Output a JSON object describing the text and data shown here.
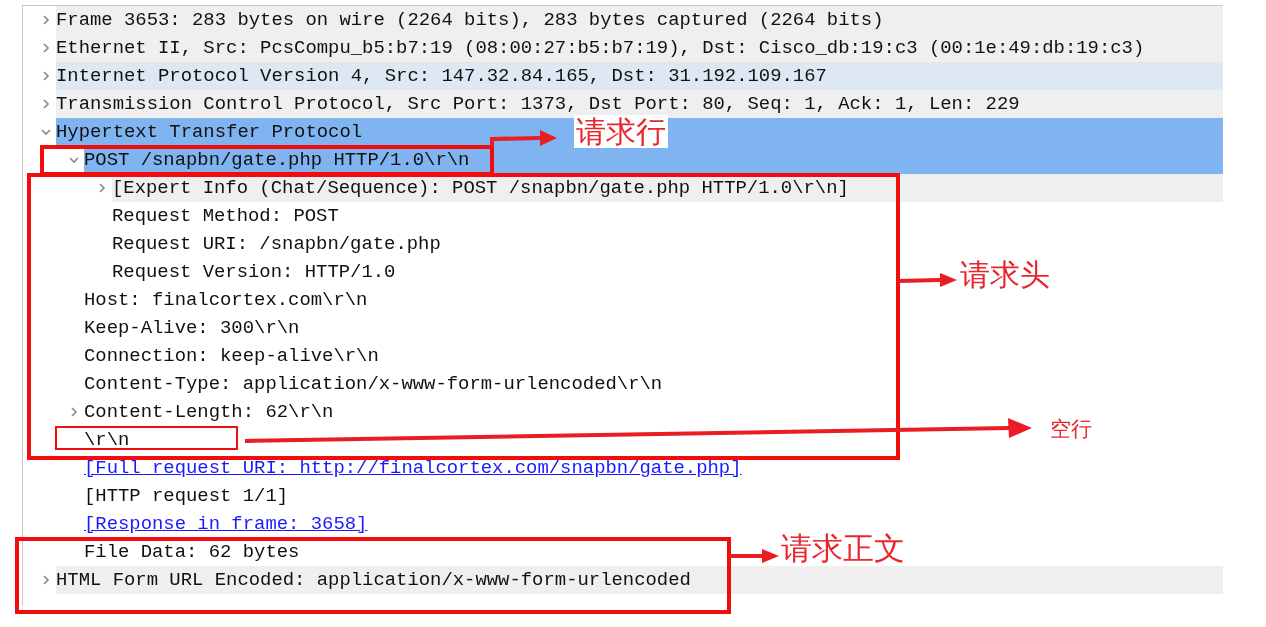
{
  "tree": [
    {
      "text": "Frame 3653: 283 bytes on wire (2264 bits), 283 bytes captured (2264 bits)",
      "expanded": false,
      "selected": false,
      "shaded": true,
      "highlighted": false
    },
    {
      "text": "Ethernet II, Src: PcsCompu_b5:b7:19 (08:00:27:b5:b7:19), Dst: Cisco_db:19:c3 (00:1e:49:db:19:c3)",
      "expanded": false,
      "selected": false,
      "shaded": true,
      "highlighted": false
    },
    {
      "text": "Internet Protocol Version 4, Src: 147.32.84.165, Dst: 31.192.109.167",
      "expanded": false,
      "selected": false,
      "shaded": false,
      "highlighted": true
    },
    {
      "text": "Transmission Control Protocol, Src Port: 1373, Dst Port: 80, Seq: 1, Ack: 1, Len: 229",
      "expanded": false,
      "selected": false,
      "shaded": true,
      "highlighted": false
    },
    {
      "text": "Hypertext Transfer Protocol",
      "expanded": true,
      "selected": true,
      "shaded": false,
      "highlighted": false,
      "children": [
        {
          "text": "POST /snapbn/gate.php HTTP/1.0\\r\\n",
          "expanded": true,
          "selected": true,
          "shaded": false,
          "children": [
            {
              "text": "[Expert Info (Chat/Sequence): POST /snapbn/gate.php HTTP/1.0\\r\\n]",
              "expanded": false,
              "selected": false,
              "shaded": true
            },
            {
              "text": "Request Method: POST",
              "selected": false,
              "shaded": false
            },
            {
              "text": "Request URI: /snapbn/gate.php",
              "selected": false,
              "shaded": false
            },
            {
              "text": "Request Version: HTTP/1.0",
              "selected": false,
              "shaded": false
            }
          ]
        },
        {
          "text": "Host: finalcortex.com\\r\\n",
          "selected": false,
          "shaded": false
        },
        {
          "text": "Keep-Alive: 300\\r\\n",
          "selected": false,
          "shaded": false
        },
        {
          "text": "Connection: keep-alive\\r\\n",
          "selected": false,
          "shaded": false
        },
        {
          "text": "Content-Type: application/x-www-form-urlencoded\\r\\n",
          "selected": false,
          "shaded": false
        },
        {
          "text": "Content-Length: 62\\r\\n",
          "expanded": false,
          "selected": false,
          "shaded": false
        },
        {
          "text": "\\r\\n",
          "selected": false,
          "shaded": false
        },
        {
          "text": "[Full request URI: http://finalcortex.com/snapbn/gate.php]",
          "kind": "link",
          "selected": false,
          "shaded": false
        },
        {
          "text": "[HTTP request 1/1]",
          "selected": false,
          "shaded": false
        },
        {
          "text": "[Response in frame: 3658]",
          "kind": "link",
          "selected": false,
          "shaded": false
        },
        {
          "text": "File Data: 62 bytes",
          "selected": false,
          "shaded": false
        }
      ]
    },
    {
      "text": "HTML Form URL Encoded: application/x-www-form-urlencoded",
      "expanded": false,
      "selected": false,
      "shaded": true,
      "highlighted": false
    }
  ],
  "annotations": [
    {
      "label": "请求行"
    },
    {
      "label": "请求头"
    },
    {
      "label": "空行"
    },
    {
      "label": "请求正文"
    }
  ]
}
